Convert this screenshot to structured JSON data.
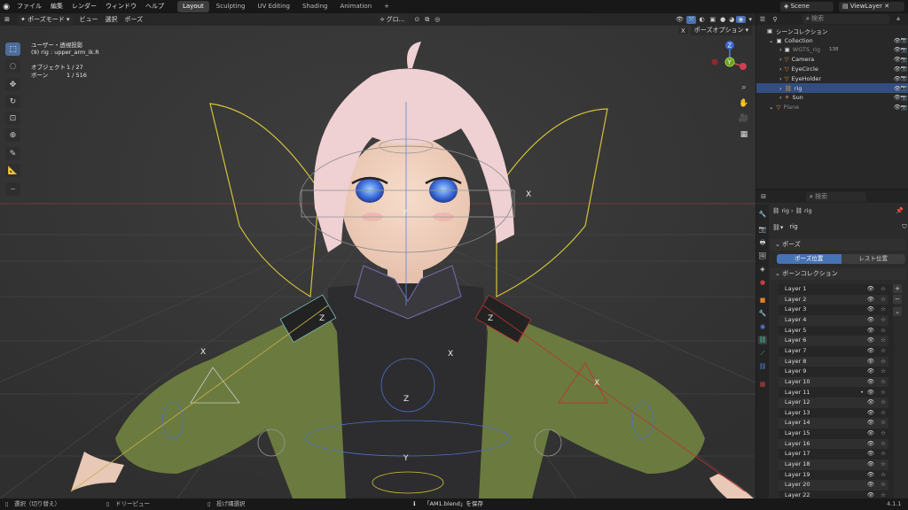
{
  "topbar": {
    "menus": [
      "ファイル",
      "編集",
      "レンダー",
      "ウィンドウ",
      "ヘルプ"
    ],
    "workspaces": [
      "Layout",
      "Sculpting",
      "UV Editing",
      "Shading",
      "Animation"
    ],
    "add_tab": "+",
    "scene": "Scene",
    "view_layer": "ViewLayer"
  },
  "viewport": {
    "mode": "ポーズモード",
    "menus": [
      "ビュー",
      "選択",
      "ポーズ"
    ],
    "transform_orientation": "グロ...",
    "pose_options": "ポーズオプション",
    "x_mirror": "X",
    "view_name": "ユーザー・透視投影",
    "active": "(9) rig : upper_arm_ik.R",
    "stats": [
      {
        "label": "オブジェクト",
        "value": "1 / 27"
      },
      {
        "label": "ボーン",
        "value": "1 / 516"
      }
    ],
    "gizmo": {
      "z": "Z",
      "y": "Y",
      "x": "X"
    }
  },
  "outliner": {
    "search_placeholder": "検索",
    "root": "シーンコレクション",
    "items": [
      {
        "name": "Collection",
        "level": 0
      },
      {
        "name": "WGTS_rig",
        "level": 1,
        "count": "138",
        "dim": true
      },
      {
        "name": "Camera",
        "level": 1
      },
      {
        "name": "EyeCircle",
        "level": 1
      },
      {
        "name": "EyeHolder",
        "level": 1
      },
      {
        "name": "rig",
        "level": 1,
        "selected": true
      },
      {
        "name": "Sun",
        "level": 1
      },
      {
        "name": "Plane",
        "level": 0,
        "dim": true
      }
    ]
  },
  "properties": {
    "search_placeholder": "検索",
    "breadcrumb": [
      "rig",
      "rig"
    ],
    "data_name": "rig",
    "pose_panel": "ポーズ",
    "pose_position": "ポーズ位置",
    "rest_position": "レスト位置",
    "collections_panel": "ボーンコレクション",
    "layers": [
      "Layer 1",
      "Layer 2",
      "Layer 3",
      "Layer 4",
      "Layer 5",
      "Layer 6",
      "Layer 7",
      "Layer 8",
      "Layer 9",
      "Layer 10",
      "Layer 11",
      "Layer 12",
      "Layer 13",
      "Layer 14",
      "Layer 15",
      "Layer 16",
      "Layer 17",
      "Layer 18",
      "Layer 19",
      "Layer 20",
      "Layer 22"
    ],
    "active_layer": "Layer 11"
  },
  "statusbar": {
    "left": "選択（切り替え）",
    "middle": "ドリーピュー",
    "right": "投げ縄選択",
    "message": "「AM1.blend」を保存",
    "version": "4.1.1"
  },
  "colors": {
    "accent": "#4772b3",
    "selection": "#334d80",
    "rig_yellow": "#d4c23a",
    "jacket": "#6b7a3e"
  }
}
